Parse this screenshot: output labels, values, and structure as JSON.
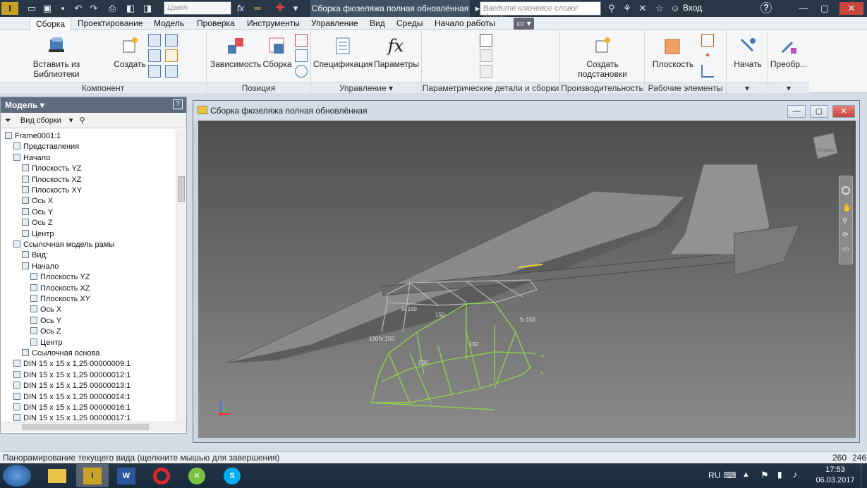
{
  "titlebar": {
    "color_placeholder": "Цвет",
    "document_title": "Сборка фюзеляжа полная обновлённая",
    "search_placeholder": "Введите ключевое слово/фразу",
    "login": "Вход",
    "help": "?"
  },
  "menu": {
    "items": [
      "Сборка",
      "Проектирование",
      "Модель",
      "Проверка",
      "Инструменты",
      "Управление",
      "Вид",
      "Среды",
      "Начало работы"
    ],
    "active": "Сборка"
  },
  "ribbon": {
    "buttons": {
      "insert_from_library": "Вставить из\nБиблиотеки компонентов",
      "create": "Создать",
      "constraint": "Зависимость",
      "assemble": "Сборка",
      "bom": "Спецификация",
      "parameters": "Параметры",
      "create_substitutes": "Создать\nподстановки",
      "plane": "Плоскость",
      "start": "Начать",
      "convert": "Преобр..."
    },
    "groups": [
      "Компонент",
      "Позиция",
      "Управление ▾",
      "Параметрические детали и сборки",
      "Производительность",
      "Рабочие элементы"
    ]
  },
  "model_panel": {
    "title": "Модель ▾",
    "view_label": "Вид сборки",
    "tree": [
      {
        "label": "Frame0001:1",
        "level": 0
      },
      {
        "label": "Представления",
        "level": 1
      },
      {
        "label": "Начало",
        "level": 1
      },
      {
        "label": "Плоскость YZ",
        "level": 2
      },
      {
        "label": "Плоскость XZ",
        "level": 2
      },
      {
        "label": "Плоскость XY",
        "level": 2
      },
      {
        "label": "Ось X",
        "level": 2
      },
      {
        "label": "Ось Y",
        "level": 2
      },
      {
        "label": "Ось Z",
        "level": 2
      },
      {
        "label": "Центр",
        "level": 2
      },
      {
        "label": "Ссылочная модель рамы",
        "level": 1
      },
      {
        "label": "Вид:",
        "level": 2
      },
      {
        "label": "Начало",
        "level": 2
      },
      {
        "label": "Плоскость YZ",
        "level": 3
      },
      {
        "label": "Плоскость XZ",
        "level": 3
      },
      {
        "label": "Плоскость XY",
        "level": 3
      },
      {
        "label": "Ось X",
        "level": 3
      },
      {
        "label": "Ось Y",
        "level": 3
      },
      {
        "label": "Ось Z",
        "level": 3
      },
      {
        "label": "Центр",
        "level": 3
      },
      {
        "label": "Ссылочная основа",
        "level": 2
      },
      {
        "label": "DIN 15 x 15 x 1,25 00000009:1",
        "level": 1
      },
      {
        "label": "DIN 15 x 15 x 1,25 00000012:1",
        "level": 1
      },
      {
        "label": "DIN 15 x 15 x 1,25 00000013:1",
        "level": 1
      },
      {
        "label": "DIN 15 x 15 x 1,25 00000014:1",
        "level": 1
      },
      {
        "label": "DIN 15 x 15 x 1,25 00000016:1",
        "level": 1
      },
      {
        "label": "DIN 15 x 15 x 1,25 00000017:1",
        "level": 1
      }
    ]
  },
  "viewport": {
    "title": "Сборка фюзеляжа полная обновлённая",
    "viewcube_label": "Справа",
    "dimensions": [
      "fx:150",
      "150",
      "fx:150",
      "150",
      "fx:150",
      "150",
      "200"
    ]
  },
  "statusbar": {
    "message": "Панорамирование текущего вида (щелкните мышью для завершения)",
    "count1": "260",
    "count2": "246"
  },
  "taskbar": {
    "lang": "RU",
    "time": "17:53",
    "date": "06.03.2017"
  },
  "colors": {
    "titlebar": "#273746",
    "ribbon": "#f4f6f8",
    "panel_header": "#5d6d7e",
    "frame_green": "#8fd14f"
  }
}
